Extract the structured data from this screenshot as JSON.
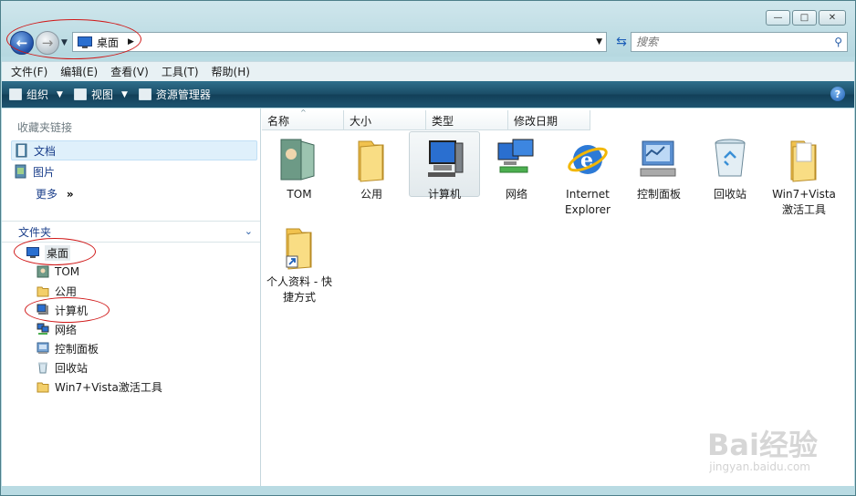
{
  "caption": {
    "minimize": "—",
    "maximize": "□",
    "close": "✕"
  },
  "address": {
    "location": "桌面",
    "separator": "▶",
    "dropdown": "▼"
  },
  "search": {
    "placeholder": "搜索"
  },
  "menu": {
    "items": [
      "文件(F)",
      "编辑(E)",
      "查看(V)",
      "工具(T)",
      "帮助(H)"
    ]
  },
  "toolbar": {
    "organize": "组织",
    "views": "视图",
    "explorer": "资源管理器",
    "help": "?"
  },
  "sidebar": {
    "favorites_heading": "收藏夹链接",
    "favorites": [
      {
        "label": "文档",
        "icon": "documents-icon",
        "selected": true
      },
      {
        "label": "图片",
        "icon": "pictures-icon",
        "selected": false
      }
    ],
    "more_label": "更多",
    "more_arrows": "»",
    "folders_heading": "文件夹",
    "folders_chevron": "⌄",
    "tree": [
      {
        "label": "桌面",
        "icon": "desktop-icon"
      },
      {
        "label": "TOM",
        "icon": "user-folder-icon"
      },
      {
        "label": "公用",
        "icon": "folder-icon"
      },
      {
        "label": "计算机",
        "icon": "computer-icon"
      },
      {
        "label": "网络",
        "icon": "network-icon"
      },
      {
        "label": "控制面板",
        "icon": "control-panel-icon"
      },
      {
        "label": "回收站",
        "icon": "recycle-bin-icon"
      },
      {
        "label": "Win7+Vista激活工具",
        "icon": "folder-icon"
      }
    ]
  },
  "columns": [
    "名称",
    "大小",
    "类型",
    "修改日期"
  ],
  "items": [
    {
      "label": "TOM",
      "icon": "user-folder-icon"
    },
    {
      "label": "公用",
      "icon": "folder-icon"
    },
    {
      "label": "计算机",
      "icon": "computer-icon",
      "selected": true
    },
    {
      "label": "网络",
      "icon": "network-icon"
    },
    {
      "label": "Internet Explorer",
      "icon": "internet-explorer-icon"
    },
    {
      "label": "控制面板",
      "icon": "control-panel-icon"
    },
    {
      "label": "回收站",
      "icon": "recycle-bin-icon"
    },
    {
      "label": "Win7+Vista 激活工具",
      "icon": "folder-icon"
    },
    {
      "label": "个人资料 - 快捷方式",
      "icon": "shortcut-folder-icon"
    }
  ],
  "watermark": {
    "main": "Bai经验",
    "sub": "jingyan.baidu.com"
  },
  "colors": {
    "accent_red": "#d01818",
    "toolbar": "#1a4c66",
    "link": "#1a3e8a"
  }
}
